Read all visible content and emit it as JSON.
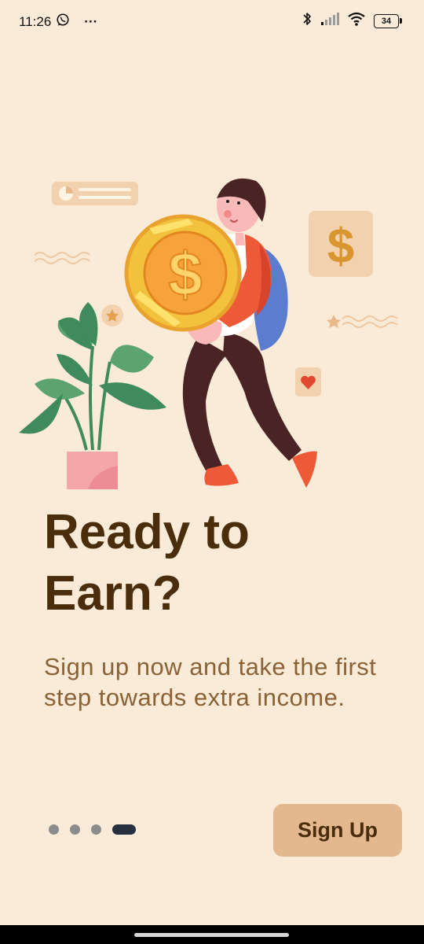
{
  "status_bar": {
    "time": "11:26",
    "more": "···",
    "battery_level": "34",
    "icons": [
      "whatsapp-icon",
      "bluetooth-icon",
      "signal-icon",
      "wifi-icon",
      "battery-icon"
    ]
  },
  "onboarding": {
    "illustration": "person-carrying-coin",
    "headline": "Ready to Earn?",
    "description": "Sign up now and take the first step towards extra income.",
    "pager": {
      "total": 4,
      "active_index": 3
    },
    "signup_label": "Sign Up"
  },
  "colors": {
    "background": "#FAEBD9",
    "headline": "#4A2D0B",
    "description": "#8A6236",
    "button": "#E4B88E",
    "dot_inactive": "#8C8C8C",
    "dot_active": "#26303F"
  }
}
